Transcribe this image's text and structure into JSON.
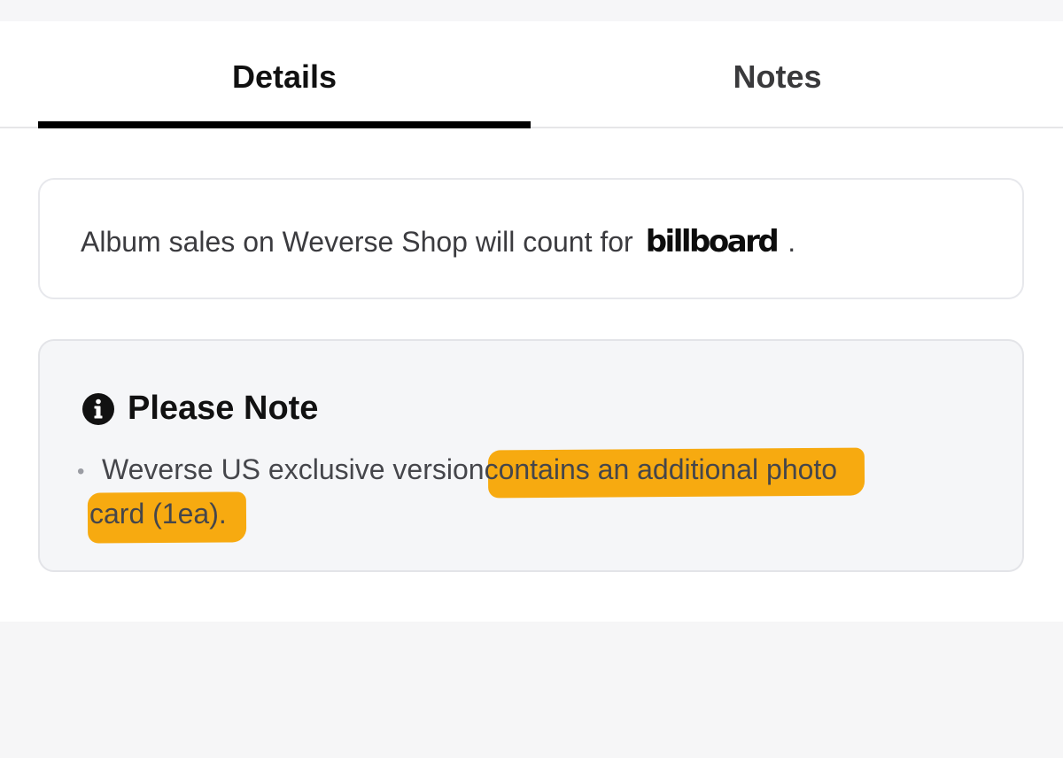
{
  "tabs": [
    {
      "label": "Details",
      "active": true
    },
    {
      "label": "Notes",
      "active": false
    }
  ],
  "billboard_notice": {
    "text": "Album sales on Weverse Shop will count for",
    "logo_text": "billboard",
    "suffix": "."
  },
  "note": {
    "icon": "info-circle-icon",
    "title": "Please Note",
    "bullet": "•",
    "line1_plain": "Weverse US exclusive version",
    "line1_highlight": "contains an additional photo",
    "line2_highlight": "card (1ea).",
    "highlight_color": "#f7aa10"
  },
  "colors": {
    "active_tab_indicator": "#000000",
    "note_background": "#f5f6f8"
  }
}
